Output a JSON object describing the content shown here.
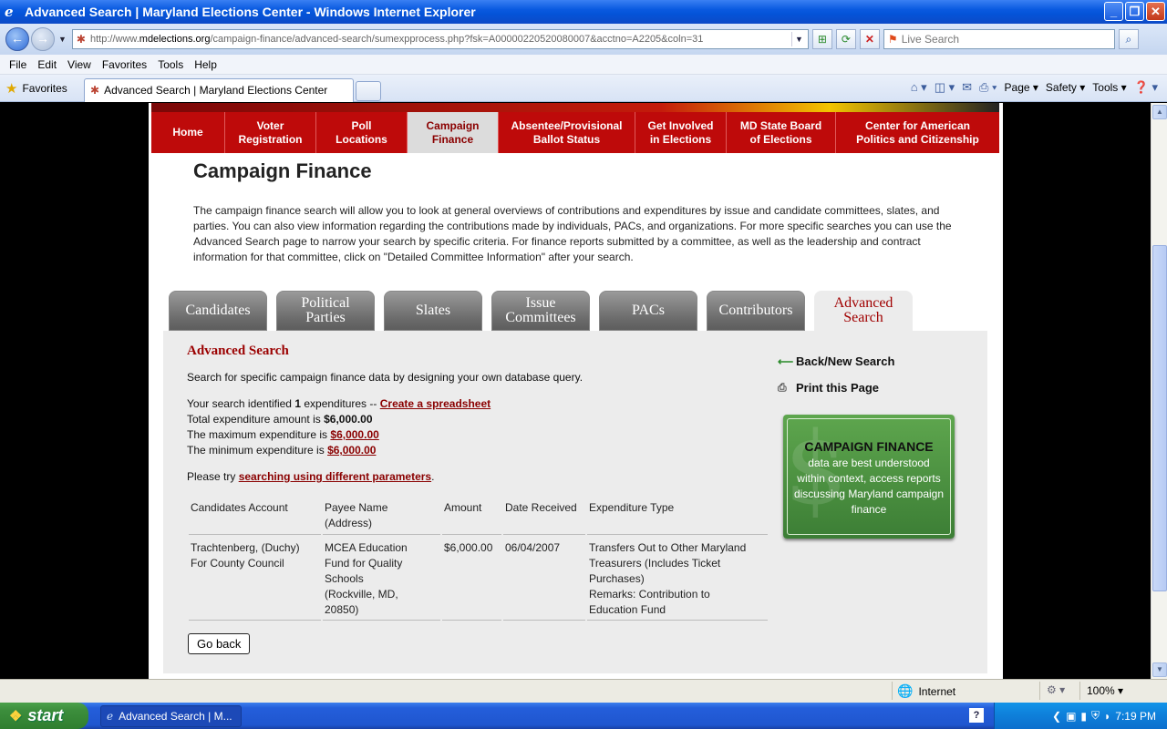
{
  "window": {
    "title": "Advanced Search | Maryland Elections Center - Windows Internet Explorer",
    "url_prefix": "http://www.",
    "url_host": "mdelections.org",
    "url_path": "/campaign-finance/advanced-search/sumexpprocess.php?fsk=A00000220520080007&acctno=A2205&coln=31",
    "search_placeholder": "Live Search"
  },
  "menu": [
    "File",
    "Edit",
    "View",
    "Favorites",
    "Tools",
    "Help"
  ],
  "tabbar": {
    "favorites_label": "Favorites",
    "tab_title": "Advanced Search | Maryland Elections Center",
    "page_label": "Page",
    "safety_label": "Safety",
    "tools_label": "Tools"
  },
  "site_nav": [
    {
      "label": "Home"
    },
    {
      "label": "Voter\nRegistration"
    },
    {
      "label": "Poll\nLocations"
    },
    {
      "label": "Campaign\nFinance",
      "active": true
    },
    {
      "label": "Absentee/Provisional\nBallot Status"
    },
    {
      "label": "Get Involved\nin Elections"
    },
    {
      "label": "MD State Board\nof Elections"
    },
    {
      "label": "Center for American\nPolitics and Citizenship"
    }
  ],
  "page": {
    "title": "Campaign Finance",
    "intro": "The campaign finance search will allow you to look at general overviews of contributions and expenditures by issue and candidate committees, slates, and parties. You can also view information regarding the contributions made by individuals, PACs, and organizations. For more specific searches you can use the Advanced Search page to narrow your search by specific criteria. For finance reports submitted by a committee, as well as the leadership and contract information for that committee, click on \"Detailed Committee Information\" after your search."
  },
  "site_tabs": [
    {
      "label": "Candidates"
    },
    {
      "label": "Political\nParties"
    },
    {
      "label": "Slates"
    },
    {
      "label": "Issue\nCommittees"
    },
    {
      "label": "PACs"
    },
    {
      "label": "Contributors"
    },
    {
      "label": "Advanced\nSearch",
      "active": true
    }
  ],
  "search": {
    "heading": "Advanced Search",
    "description": "Search for specific campaign finance data by designing your own database query.",
    "identified_prefix": "Your search identified",
    "identified_count": "1",
    "identified_suffix": "expenditures --",
    "spreadsheet_link": "Create a spreadsheet",
    "total_label": "Total expenditure amount is",
    "total_value": "$6,000.00",
    "max_label": "The maximum expenditure is",
    "max_value": "$6,000.00",
    "min_label": "The minimum expenditure is",
    "min_value": "$6,000.00",
    "retry_prefix": "Please try",
    "retry_link": "searching using different parameters",
    "retry_suffix": "."
  },
  "table": {
    "headers": [
      "Candidates Account",
      "Payee Name\n(Address)",
      "Amount",
      "Date Received",
      "Expenditure Type"
    ],
    "rows": [
      [
        "Trachtenberg, (Duchy)\nFor County Council",
        "MCEA Education\nFund for Quality\nSchools\n(Rockville, MD,\n20850)",
        "$6,000.00",
        "06/04/2007",
        "Transfers Out to Other Maryland\nTreasurers (Includes Ticket\nPurchases)\nRemarks: Contribution to\nEducation Fund"
      ]
    ]
  },
  "go_back_label": "Go back",
  "side": {
    "back_link": "Back/New Search",
    "print_link": "Print this Page",
    "box_title": "CAMPAIGN FINANCE",
    "box_text": "data are best understood within context, access reports discussing Maryland campaign finance"
  },
  "status": {
    "zone": "Internet",
    "zoom": "100%"
  },
  "taskbar": {
    "start": "start",
    "task": "Advanced Search | M...",
    "clock": "7:19 PM"
  }
}
